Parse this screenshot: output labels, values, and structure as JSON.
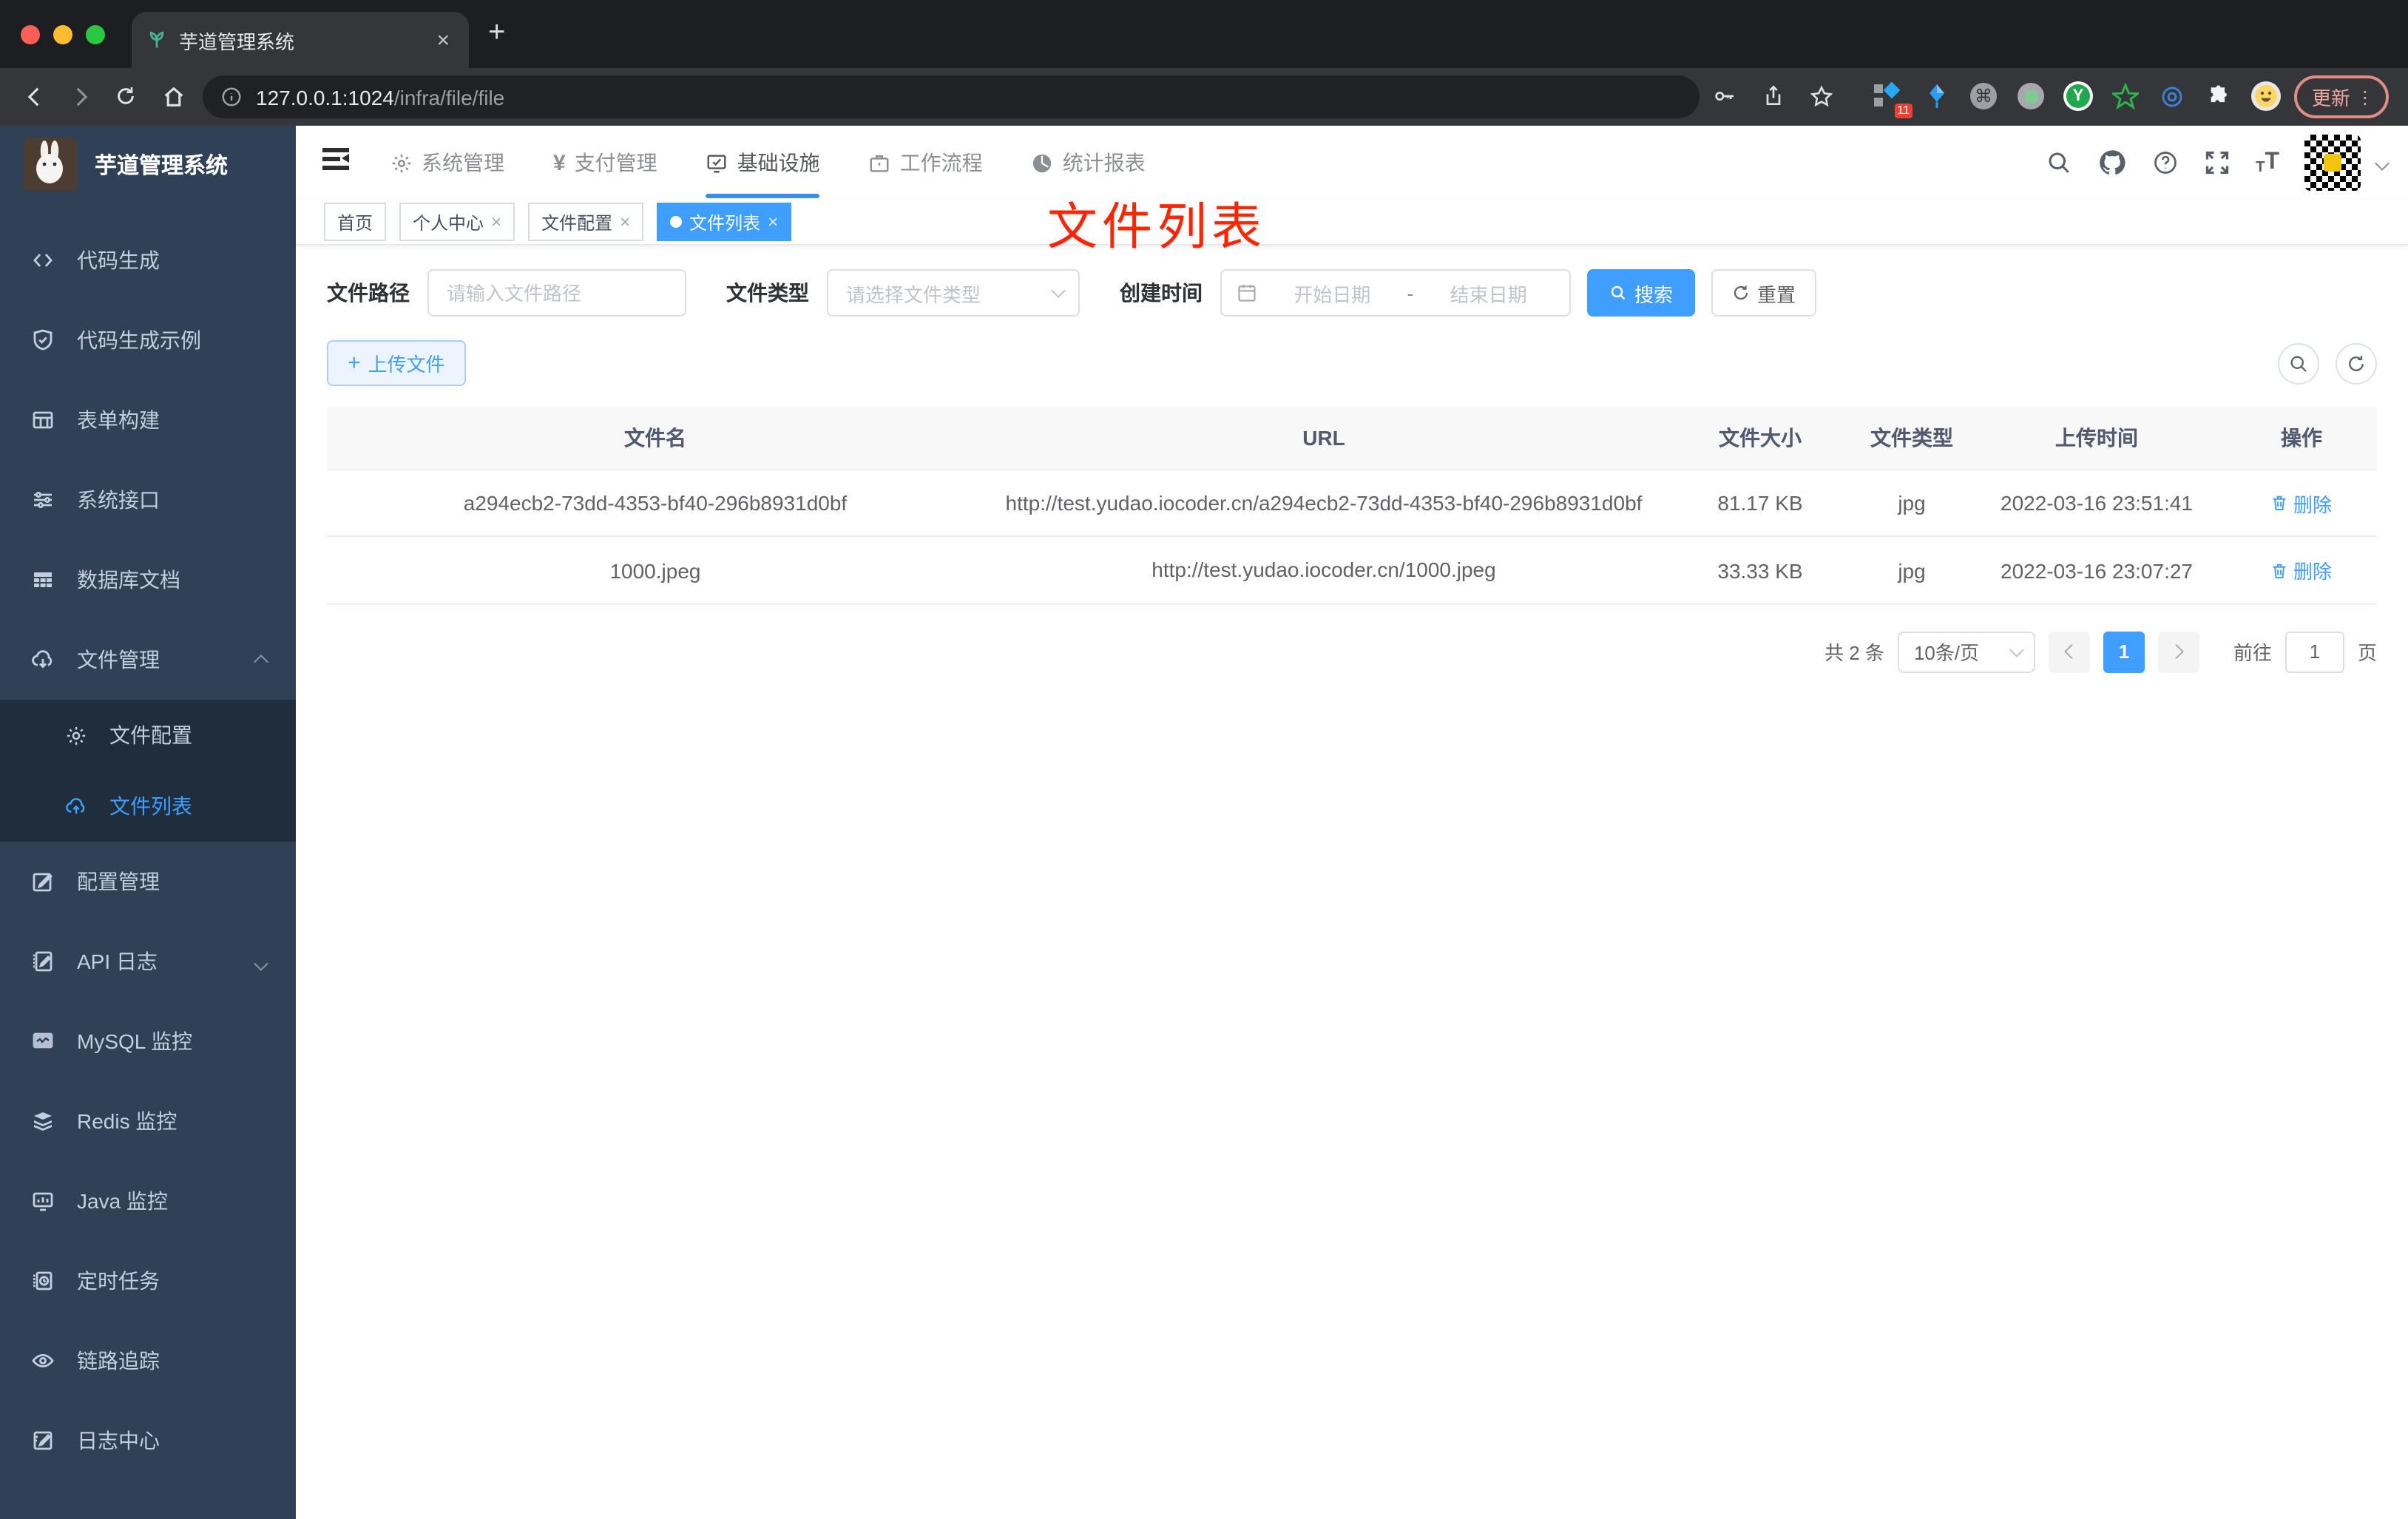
{
  "browser": {
    "tab_title": "芋道管理系统",
    "url_origin": "127.0.0.1:1024",
    "url_path": "/infra/file/file",
    "extension_badge": "11",
    "update_label": "更新"
  },
  "sidebar": {
    "title": "芋道管理系统",
    "items": [
      {
        "label": "代码生成"
      },
      {
        "label": "代码生成示例"
      },
      {
        "label": "表单构建"
      },
      {
        "label": "系统接口"
      },
      {
        "label": "数据库文档"
      },
      {
        "label": "文件管理"
      },
      {
        "label": "文件配置"
      },
      {
        "label": "文件列表"
      },
      {
        "label": "配置管理"
      },
      {
        "label": "API 日志"
      },
      {
        "label": "MySQL 监控"
      },
      {
        "label": "Redis 监控"
      },
      {
        "label": "Java 监控"
      },
      {
        "label": "定时任务"
      },
      {
        "label": "链路追踪"
      },
      {
        "label": "日志中心"
      }
    ]
  },
  "header": {
    "nav": [
      {
        "label": "系统管理"
      },
      {
        "label": "支付管理"
      },
      {
        "label": "基础设施"
      },
      {
        "label": "工作流程"
      },
      {
        "label": "统计报表"
      }
    ]
  },
  "tags": {
    "items": [
      {
        "label": "首页"
      },
      {
        "label": "个人中心"
      },
      {
        "label": "文件配置"
      },
      {
        "label": "文件列表"
      }
    ]
  },
  "annotation": {
    "text": "文件列表",
    "color": "#fe2505"
  },
  "filters": {
    "path_label": "文件路径",
    "path_placeholder": "请输入文件路径",
    "type_label": "文件类型",
    "type_placeholder": "请选择文件类型",
    "date_label": "创建时间",
    "date_start": "开始日期",
    "date_separator": "-",
    "date_end": "结束日期",
    "search_label": "搜索",
    "reset_label": "重置"
  },
  "toolbar": {
    "upload_label": "上传文件",
    "plus": "+"
  },
  "table": {
    "headers": [
      "文件名",
      "URL",
      "文件大小",
      "文件类型",
      "上传时间",
      "操作"
    ],
    "rows": [
      {
        "name": "a294ecb2-73dd-4353-bf40-296b8931d0bf",
        "url": "http://test.yudao.iocoder.cn/a294ecb2-73dd-4353-bf40-296b8931d0bf",
        "size": "81.17 KB",
        "type": "jpg",
        "time": "2022-03-16 23:51:41",
        "action": "删除"
      },
      {
        "name": "1000.jpeg",
        "url": "http://test.yudao.iocoder.cn/1000.jpeg",
        "size": "33.33 KB",
        "type": "jpg",
        "time": "2022-03-16 23:07:27",
        "action": "删除"
      }
    ]
  },
  "pagination": {
    "total": "共 2 条",
    "page_size": "10条/页",
    "current": "1",
    "goto_label": "前往",
    "goto_value": "1",
    "page_unit": "页"
  },
  "colors": {
    "accent": "#409eff",
    "annotation_red": "#fe2505",
    "sidebar_bg": "#304156"
  }
}
